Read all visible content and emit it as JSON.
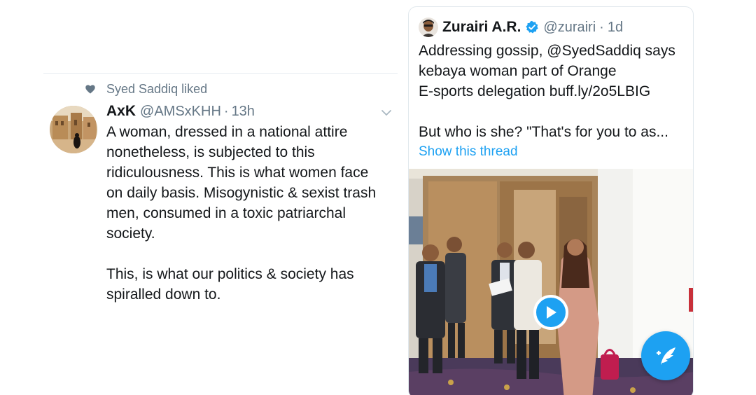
{
  "left_tweet": {
    "social_context": "Syed Saddiq liked",
    "author_name": "AxK",
    "author_handle": "@AMSxKHH",
    "separator": "·",
    "time": "13h",
    "body_lines": [
      "A woman, dressed in a national attire",
      "nonetheless, is subjected to this",
      "ridiculousness. This is what women face",
      "on daily basis. Misogynistic & sexist trash",
      "men, consumed in a toxic patriarchal",
      "society."
    ],
    "body_lines_2": [
      "This, is what our politics & society has",
      "spiralled down to."
    ]
  },
  "right_tweet": {
    "author_name": "Zurairi A.R.",
    "author_handle": "@zurairi",
    "separator": "·",
    "time": "1d",
    "body_lines": [
      "Addressing gossip, @SyedSaddiq says",
      "kebaya woman part of Orange",
      "E-sports delegation buff.ly/2o5LBIG"
    ],
    "body_lines_2": [
      "But who is she? \"That's for you to as..."
    ],
    "show_thread": "Show this thread"
  },
  "icons": {
    "heart": "heart-icon",
    "chevron": "chevron-down-icon",
    "verified": "verified-badge-icon",
    "play": "play-icon",
    "compose": "compose-tweet-icon"
  },
  "colors": {
    "accent": "#1da1f2",
    "secondary_text": "#657786",
    "primary_text": "#14171a"
  }
}
